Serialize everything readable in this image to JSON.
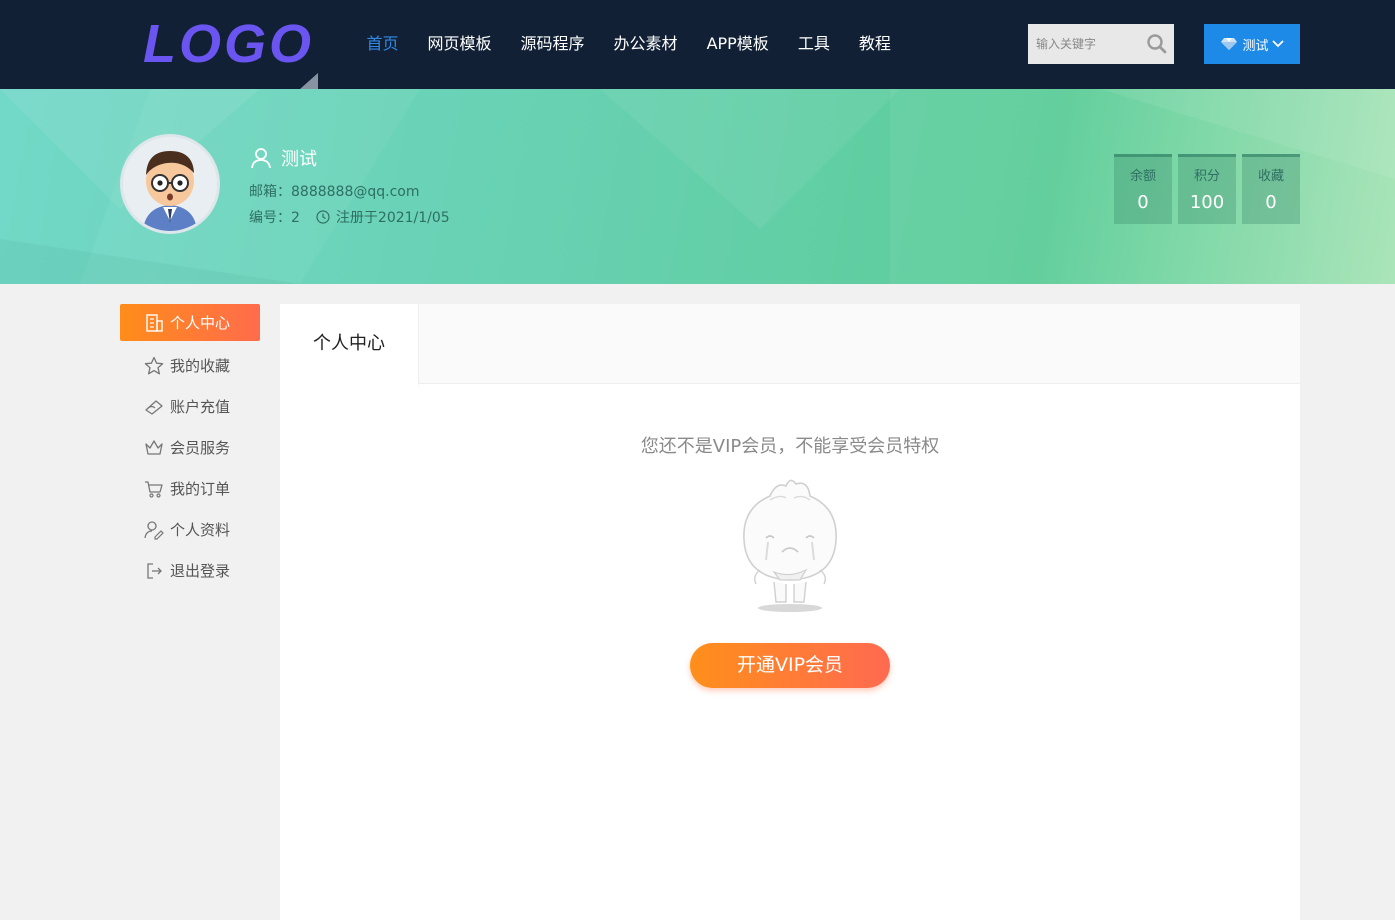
{
  "header": {
    "logo_text": "LOGO",
    "nav": [
      {
        "label": "首页",
        "active": true
      },
      {
        "label": "网页模板",
        "active": false
      },
      {
        "label": "源码程序",
        "active": false
      },
      {
        "label": "办公素材",
        "active": false
      },
      {
        "label": "APP模板",
        "active": false
      },
      {
        "label": "工具",
        "active": false
      },
      {
        "label": "教程",
        "active": false
      }
    ],
    "search": {
      "placeholder": "输入关键字",
      "icon": "search-icon"
    },
    "user_menu": {
      "label": "测试",
      "icon": "diamond-icon"
    }
  },
  "profile": {
    "username": "测试",
    "email": "邮箱：8888888@qq.com",
    "id": "编号：2",
    "registered": "注册于2021/1/05",
    "stats": [
      {
        "label": "余额",
        "value": "0"
      },
      {
        "label": "积分",
        "value": "100"
      },
      {
        "label": "收藏",
        "value": "0"
      }
    ]
  },
  "sidebar": {
    "items": [
      {
        "label": "个人中心",
        "icon": "building-icon",
        "active": true
      },
      {
        "label": "我的收藏",
        "icon": "star-icon",
        "active": false
      },
      {
        "label": "账户充值",
        "icon": "wallet-icon",
        "active": false
      },
      {
        "label": "会员服务",
        "icon": "crown-icon",
        "active": false
      },
      {
        "label": "我的订单",
        "icon": "cart-icon",
        "active": false
      },
      {
        "label": "个人资料",
        "icon": "user-edit-icon",
        "active": false
      },
      {
        "label": "退出登录",
        "icon": "logout-icon",
        "active": false
      }
    ]
  },
  "main": {
    "tab_label": "个人中心",
    "notice": "您还不是VIP会员，不能享受会员特权",
    "vip_button": "开通VIP会员"
  },
  "colors": {
    "nav_bg": "#112035",
    "nav_active": "#2e8ae6",
    "accent_orange": "#ff8c1a",
    "banner_green": "#66d0ae",
    "user_button": "#1e8ae8"
  }
}
